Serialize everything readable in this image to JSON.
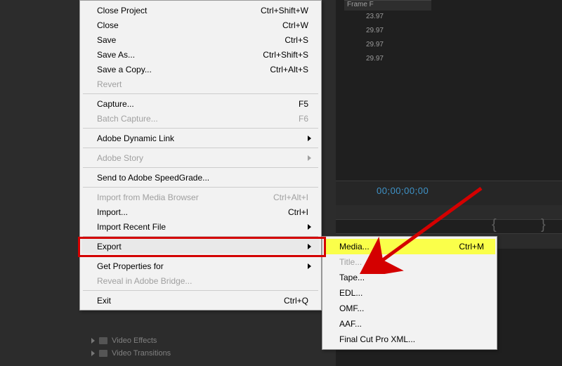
{
  "frame_header": "Frame F",
  "frame_values": [
    "23.97",
    "29.97",
    "29.97",
    "29.97"
  ],
  "timecode": "00;00;00;00",
  "menu": {
    "groups": [
      [
        {
          "id": "close-project",
          "label": "Close Project",
          "shortcut": "Ctrl+Shift+W",
          "disabled": false,
          "submenu": false
        },
        {
          "id": "close",
          "label": "Close",
          "shortcut": "Ctrl+W",
          "disabled": false,
          "submenu": false
        },
        {
          "id": "save",
          "label": "Save",
          "shortcut": "Ctrl+S",
          "disabled": false,
          "submenu": false
        },
        {
          "id": "save-as",
          "label": "Save As...",
          "shortcut": "Ctrl+Shift+S",
          "disabled": false,
          "submenu": false
        },
        {
          "id": "save-copy",
          "label": "Save a Copy...",
          "shortcut": "Ctrl+Alt+S",
          "disabled": false,
          "submenu": false
        },
        {
          "id": "revert",
          "label": "Revert",
          "shortcut": "",
          "disabled": true,
          "submenu": false
        }
      ],
      [
        {
          "id": "capture",
          "label": "Capture...",
          "shortcut": "F5",
          "disabled": false,
          "submenu": false
        },
        {
          "id": "batch-capture",
          "label": "Batch Capture...",
          "shortcut": "F6",
          "disabled": true,
          "submenu": false
        }
      ],
      [
        {
          "id": "dynamic-link",
          "label": "Adobe Dynamic Link",
          "shortcut": "",
          "disabled": false,
          "submenu": true
        }
      ],
      [
        {
          "id": "adobe-story",
          "label": "Adobe Story",
          "shortcut": "",
          "disabled": true,
          "submenu": true
        }
      ],
      [
        {
          "id": "send-speedgrade",
          "label": "Send to Adobe SpeedGrade...",
          "shortcut": "",
          "disabled": false,
          "submenu": false
        }
      ],
      [
        {
          "id": "import-media-browser",
          "label": "Import from Media Browser",
          "shortcut": "Ctrl+Alt+I",
          "disabled": true,
          "submenu": false
        },
        {
          "id": "import",
          "label": "Import...",
          "shortcut": "Ctrl+I",
          "disabled": false,
          "submenu": false
        },
        {
          "id": "import-recent",
          "label": "Import Recent File",
          "shortcut": "",
          "disabled": false,
          "submenu": true
        }
      ],
      [
        {
          "id": "export",
          "label": "Export",
          "shortcut": "",
          "disabled": false,
          "submenu": true,
          "highlighted": true
        }
      ],
      [
        {
          "id": "get-properties",
          "label": "Get Properties for",
          "shortcut": "",
          "disabled": false,
          "submenu": true
        },
        {
          "id": "reveal-bridge",
          "label": "Reveal in Adobe Bridge...",
          "shortcut": "",
          "disabled": true,
          "submenu": false
        }
      ],
      [
        {
          "id": "exit",
          "label": "Exit",
          "shortcut": "Ctrl+Q",
          "disabled": false,
          "submenu": false
        }
      ]
    ]
  },
  "submenu": {
    "items": [
      {
        "id": "media",
        "label": "Media...",
        "shortcut": "Ctrl+M",
        "disabled": false,
        "highlighted": true
      },
      {
        "id": "title",
        "label": "Title...",
        "shortcut": "",
        "disabled": true
      },
      {
        "id": "tape",
        "label": "Tape...",
        "shortcut": "",
        "disabled": false
      },
      {
        "id": "edl",
        "label": "EDL...",
        "shortcut": "",
        "disabled": false
      },
      {
        "id": "omf",
        "label": "OMF...",
        "shortcut": "",
        "disabled": false
      },
      {
        "id": "aaf",
        "label": "AAF...",
        "shortcut": "",
        "disabled": false
      },
      {
        "id": "fcp-xml",
        "label": "Final Cut Pro XML...",
        "shortcut": "",
        "disabled": false
      }
    ]
  },
  "project_panel": {
    "items": [
      "Video Effects",
      "Video Transitions"
    ]
  },
  "colors": {
    "annotation_red": "#d40000",
    "highlight_yellow": "#faff4a",
    "timecode_blue": "#3f93c8"
  }
}
